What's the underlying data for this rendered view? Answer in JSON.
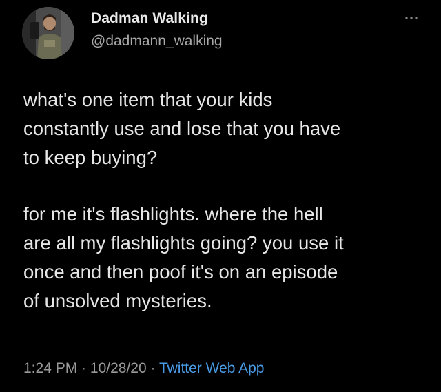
{
  "author": {
    "display_name": "Dadman Walking",
    "handle": "@dadmann_walking"
  },
  "menu_icon": "more-horizontal-icon",
  "tweet": {
    "paragraph1": [
      "what's one item that your kids",
      "constantly use and lose that you have",
      "to keep buying?"
    ],
    "paragraph2": [
      "for me it's flashlights. where the hell",
      "are all my flashlights going? you use it",
      "once and then poof it's on an episode",
      "of unsolved mysteries."
    ]
  },
  "meta": {
    "time": "1:24 PM",
    "separator": " · ",
    "date": "10/28/20",
    "source": "Twitter Web App"
  },
  "colors": {
    "background": "#000000",
    "link": "#4a9be6",
    "muted": "#9a9a9a"
  }
}
